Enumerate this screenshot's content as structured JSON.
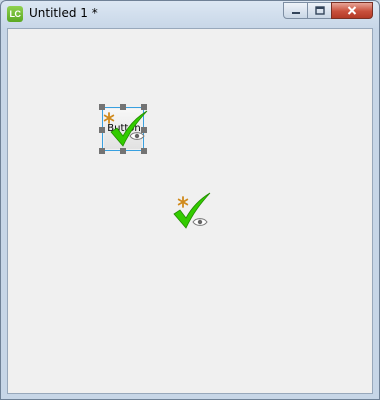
{
  "window": {
    "app_icon_label": "LC",
    "title": "Untitled 1 *"
  },
  "canvas": {
    "selected_control": {
      "type": "button",
      "label": "Button",
      "status_icons": [
        "asterisk-icon",
        "checkmark-icon",
        "eye-icon"
      ]
    },
    "free_icons": [
      "asterisk-icon",
      "checkmark-icon",
      "eye-icon"
    ]
  },
  "colors": {
    "accent_check": "#33cc00",
    "asterisk": "#d08a1c",
    "selection": "#38a0e0",
    "handle": "#737373",
    "close_button": "#c9503c"
  }
}
